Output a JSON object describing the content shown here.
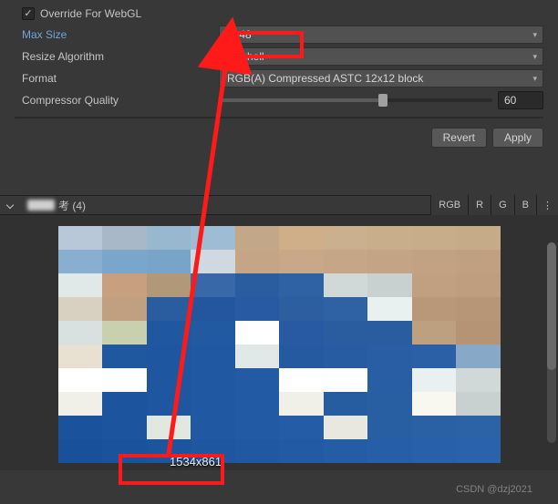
{
  "inspector": {
    "override": {
      "label": "Override For WebGL",
      "checked": true
    },
    "maxSize": {
      "label": "Max Size",
      "value": "2048"
    },
    "resizeAlgorithm": {
      "label": "Resize Algorithm",
      "value": "Mitchell"
    },
    "format": {
      "label": "Format",
      "value": "RGB(A) Compressed ASTC 12x12 block"
    },
    "compressorQuality": {
      "label": "Compressor Quality",
      "value": "60"
    }
  },
  "buttons": {
    "revert": "Revert",
    "apply": "Apply"
  },
  "preview": {
    "title": "考 (4)",
    "channels": {
      "rgb": "RGB",
      "r": "R",
      "g": "G",
      "b": "B"
    },
    "dimensions": "1534x861"
  },
  "watermark": "CSDN @dzj2021",
  "colors": {
    "annotation": "#ff1a1a"
  }
}
